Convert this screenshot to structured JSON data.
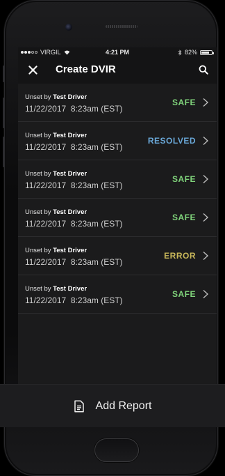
{
  "status_bar": {
    "carrier": "VIRGIL",
    "time": "4:21 PM",
    "battery": "82%",
    "battery_level": 0.82,
    "icons": [
      "signal-dots-icon",
      "wifi-icon",
      "bluetooth-icon",
      "battery-icon"
    ]
  },
  "header": {
    "title": "Create DVIR",
    "close_icon": "close-icon",
    "search_icon": "search-icon"
  },
  "reports": [
    {
      "prefix": "Unset by",
      "driver": "Test Driver",
      "datetime": "11/22/2017  8:23am (EST)",
      "status": "SAFE",
      "status_color": "#7fd27a"
    },
    {
      "prefix": "Unset by",
      "driver": "Test Driver",
      "datetime": "11/22/2017  8:23am (EST)",
      "status": "RESOLVED",
      "status_color": "#6aa8d8"
    },
    {
      "prefix": "Unset by",
      "driver": "Test Driver",
      "datetime": "11/22/2017  8:23am (EST)",
      "status": "SAFE",
      "status_color": "#7fd27a"
    },
    {
      "prefix": "Unset by",
      "driver": "Test Driver",
      "datetime": "11/22/2017  8:23am (EST)",
      "status": "SAFE",
      "status_color": "#7fd27a"
    },
    {
      "prefix": "Unset by",
      "driver": "Test Driver",
      "datetime": "11/22/2017  8:23am (EST)",
      "status": "ERROR",
      "status_color": "#c9b85a"
    },
    {
      "prefix": "Unset by",
      "driver": "Test Driver",
      "datetime": "11/22/2017  8:23am (EST)",
      "status": "SAFE",
      "status_color": "#7fd27a"
    }
  ],
  "footer": {
    "add_report_label": "Add Report",
    "icon": "document-icon"
  },
  "colors": {
    "screen_bg": "#1b1b1c",
    "header_bg": "#141415",
    "safe": "#7fd27a",
    "resolved": "#6aa8d8",
    "error": "#c9b85a"
  }
}
